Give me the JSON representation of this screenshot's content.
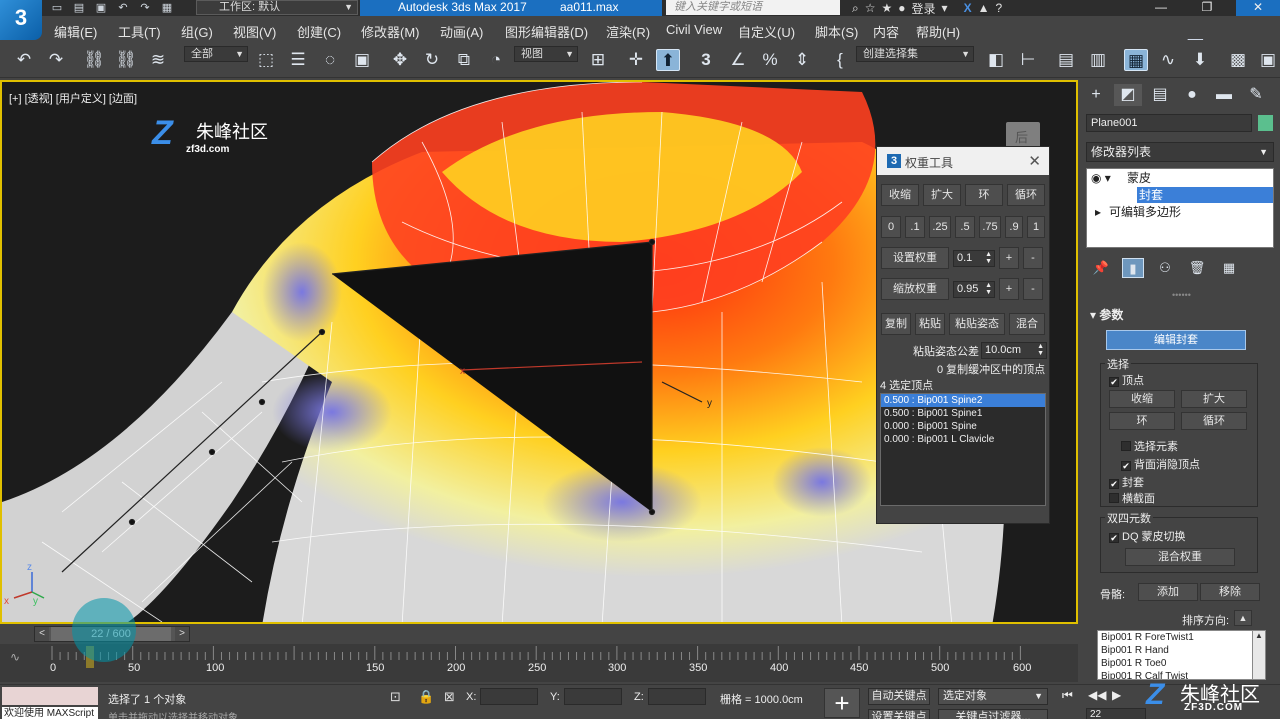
{
  "titlebar": {
    "logo": "3",
    "workspace_label": "工作区: 默认",
    "app_title": "Autodesk 3ds Max 2017",
    "file_name": "aa011.max",
    "search_placeholder": "键入关键字或短语",
    "login_label": "登录",
    "help_label": "?"
  },
  "menu": [
    "编辑(E)",
    "工具(T)",
    "组(G)",
    "视图(V)",
    "创建(C)",
    "修改器(M)",
    "动画(A)",
    "图形编辑器(D)",
    "渲染(R)",
    "Civil View",
    "自定义(U)",
    "脚本(S)",
    "内容",
    "帮助(H)"
  ],
  "toolbar": {
    "filter_dropdown": "全部",
    "refcoord_dropdown": "视图",
    "selection_set_dropdown": "创建选择集",
    "snap_label": "3"
  },
  "viewport": {
    "label": "[+] [透视] [用户定义] [边面]",
    "watermark_text": "朱峰社区",
    "watermark_url": "zf3d.com",
    "viewcube_label": "后",
    "axis_labels": {
      "x": "x",
      "y": "y",
      "z": "z"
    }
  },
  "weight_tool": {
    "title": "权重工具",
    "shrink": "收缩",
    "grow": "扩大",
    "ring": "环",
    "loop": "循环",
    "presets": [
      "0",
      ".1",
      ".25",
      ".5",
      ".75",
      ".9",
      "1"
    ],
    "set_weight": "设置权重",
    "set_weight_value": "0.1",
    "scale_weight": "缩放权重",
    "scale_weight_value": "0.95",
    "plus": "+",
    "minus": "-",
    "copy": "复制",
    "paste": "粘贴",
    "paste_pos": "粘贴姿态",
    "blend": "混合",
    "paste_tolerance_label": "粘贴姿态公差",
    "paste_tolerance_value": "10.0cm",
    "buffer_status": "0 复制缓冲区中的顶点",
    "selected_count": "4 选定顶点",
    "weights": [
      {
        "text": "0.500 : Bip001 Spine2",
        "selected": true
      },
      {
        "text": "0.500 : Bip001 Spine1",
        "selected": false
      },
      {
        "text": "0.000 : Bip001 Spine",
        "selected": false
      },
      {
        "text": "0.000 : Bip001 L Clavicle",
        "selected": false
      }
    ]
  },
  "command_panel": {
    "object_name": "Plane001",
    "object_color": "#5bbf8e",
    "modifier_list": "修改器列表",
    "stack": {
      "skin": "蒙皮",
      "envelope": "封套",
      "editable_poly": "可编辑多边形"
    },
    "params_title": "参数",
    "edit_envelopes": "编辑封套",
    "select_group": "选择",
    "vertices": "顶点",
    "shrink": "收缩",
    "grow": "扩大",
    "ring": "环",
    "loop": "循环",
    "select_element": "选择元素",
    "backface_cull": "背面消隐顶点",
    "envelopes": "封套",
    "cross_sections": "横截面",
    "dual_quat_group": "双四元数",
    "dq_toggle": "DQ 蒙皮切换",
    "blend_weights": "混合权重",
    "bones_label": "骨骼:",
    "add": "添加",
    "remove": "移除",
    "sort_label": "排序方向:",
    "bones": [
      "Bip001 R ForeTwist1",
      "Bip001 R Hand",
      "Bip001 R Toe0",
      "Bip001 R Calf Twist"
    ]
  },
  "timeline": {
    "slider_label": "22 / 600",
    "ticks": [
      "0",
      "50",
      "100",
      "150",
      "200",
      "250",
      "300",
      "350",
      "400",
      "450",
      "500",
      "550",
      "600"
    ]
  },
  "status": {
    "listener_text": "欢迎使用 MAXScript",
    "selection_text": "选择了 1 个对象",
    "hint_text": "单击并拖动以选择并移动对象",
    "x_label": "X:",
    "y_label": "Y:",
    "z_label": "Z:",
    "grid_label": "栅格 = 1000.0cm",
    "auto_key": "自动关键点",
    "set_key": "设置关键点",
    "selected_object": "选定对象",
    "key_filters": "关键点过滤器...",
    "frame_value": "22"
  },
  "bottom_watermark": {
    "text": "朱峰社区",
    "url": "ZF3D.COM"
  }
}
